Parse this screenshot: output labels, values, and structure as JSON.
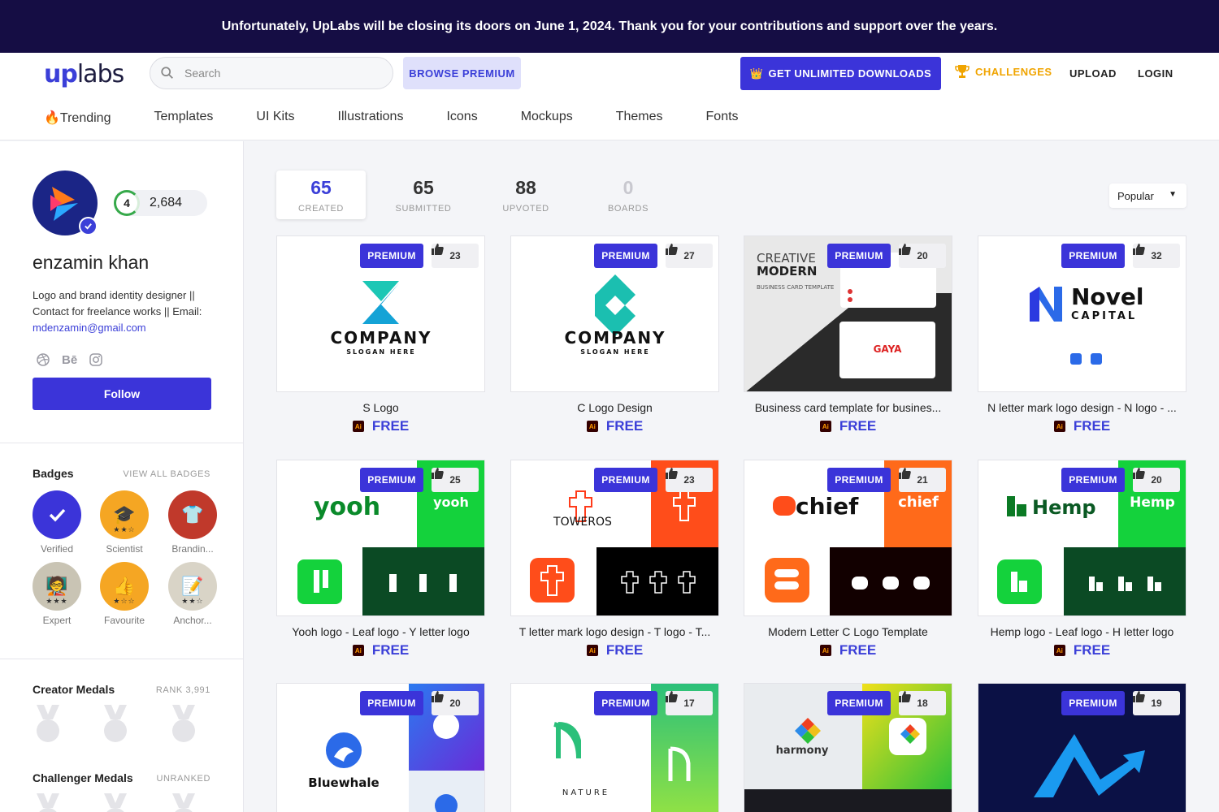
{
  "banner": {
    "text": "Unfortunately, UpLabs will be closing its doors on June 1, 2024. Thank you for your contributions and support over the years."
  },
  "header": {
    "logo_up": "up",
    "logo_labs": "labs",
    "search_placeholder": "Search",
    "browse_premium": "BROWSE PREMIUM",
    "unlimited": "GET UNLIMITED DOWNLOADS",
    "challenges": "CHALLENGES",
    "upload": "UPLOAD",
    "login": "LOGIN"
  },
  "nav": [
    "🔥Trending",
    "Templates",
    "UI Kits",
    "Illustrations",
    "Icons",
    "Mockups",
    "Themes",
    "Fonts"
  ],
  "profile": {
    "level": "4",
    "score": "2,684",
    "name": "enzamin khan",
    "bio": "Logo and brand identity designer || Contact for freelance works || Email:",
    "email": "mdenzamin@gmail.com",
    "social_behance": "Bē",
    "follow": "Follow"
  },
  "badges": {
    "title": "Badges",
    "view_all": "VIEW ALL BADGES",
    "items": [
      {
        "label": "Verified",
        "color": "#3b34d9",
        "icon": "check-icon",
        "stars": ""
      },
      {
        "label": "Scientist",
        "color": "#f5a623",
        "icon": "mortarboard-icon",
        "stars": "★★☆"
      },
      {
        "label": "Brandin...",
        "color": "#c0392b",
        "icon": "shirt-icon",
        "stars": ""
      },
      {
        "label": "Expert",
        "color": "#c9c4b4",
        "icon": "person-icon",
        "stars": "★★★"
      },
      {
        "label": "Favourite",
        "color": "#f5a623",
        "icon": "thumbs-up-icon",
        "stars": "★☆☆"
      },
      {
        "label": "Anchor...",
        "color": "#d9d4c7",
        "icon": "notepad-icon",
        "stars": "★★☆"
      }
    ]
  },
  "creator_medals": {
    "title": "Creator Medals",
    "rank": "RANK 3,991"
  },
  "challenger_medals": {
    "title": "Challenger Medals",
    "rank": "UNRANKED"
  },
  "tabs": [
    {
      "num": "65",
      "label": "CREATED"
    },
    {
      "num": "65",
      "label": "SUBMITTED"
    },
    {
      "num": "88",
      "label": "UPVOTED"
    },
    {
      "num": "0",
      "label": "BOARDS"
    }
  ],
  "sort": {
    "selected": "Popular"
  },
  "cards": [
    {
      "title": "S Logo",
      "likes": "23",
      "premium": "PREMIUM",
      "price": "FREE",
      "art": "s-logo"
    },
    {
      "title": "C Logo Design",
      "likes": "27",
      "premium": "PREMIUM",
      "price": "FREE",
      "art": "c-logo"
    },
    {
      "title": "Business card template for busines...",
      "likes": "20",
      "premium": "PREMIUM",
      "price": "FREE",
      "art": "business-card"
    },
    {
      "title": "N letter mark logo design - N logo - ...",
      "likes": "32",
      "premium": "PREMIUM",
      "price": "FREE",
      "art": "novel"
    },
    {
      "title": "Yooh logo - Leaf logo - Y letter logo",
      "likes": "25",
      "premium": "PREMIUM",
      "price": "FREE",
      "art": "yooh"
    },
    {
      "title": "T letter mark logo design - T logo - T...",
      "likes": "23",
      "premium": "PREMIUM",
      "price": "FREE",
      "art": "toweros"
    },
    {
      "title": "Modern Letter C Logo Template",
      "likes": "21",
      "premium": "PREMIUM",
      "price": "FREE",
      "art": "chief"
    },
    {
      "title": "Hemp logo - Leaf logo - H letter logo",
      "likes": "20",
      "premium": "PREMIUM",
      "price": "FREE",
      "art": "hemp"
    },
    {
      "title": "",
      "likes": "20",
      "premium": "PREMIUM",
      "price": "",
      "art": "bluewhale"
    },
    {
      "title": "",
      "likes": "17",
      "premium": "PREMIUM",
      "price": "",
      "art": "nature"
    },
    {
      "title": "",
      "likes": "18",
      "premium": "PREMIUM",
      "price": "",
      "art": "harmony"
    },
    {
      "title": "",
      "likes": "19",
      "premium": "PREMIUM",
      "price": "",
      "art": "arrow"
    }
  ],
  "thumb_text": {
    "company": "COMPANY",
    "slogan": "SLOGAN HERE",
    "creative": "CREATIVE",
    "modern": "MODERN",
    "bc_sub": "BUSINESS CARD TEMPLATE",
    "gaya": "GAYA",
    "novel": "Novel",
    "capital": "CAPITAL",
    "yooh": "yooh",
    "toweros": "TOWEROS",
    "chief": "chief",
    "hemp": "Hemp",
    "bluewhale": "Bluewhale",
    "nature": "NATURE",
    "harmony": "harmony"
  }
}
